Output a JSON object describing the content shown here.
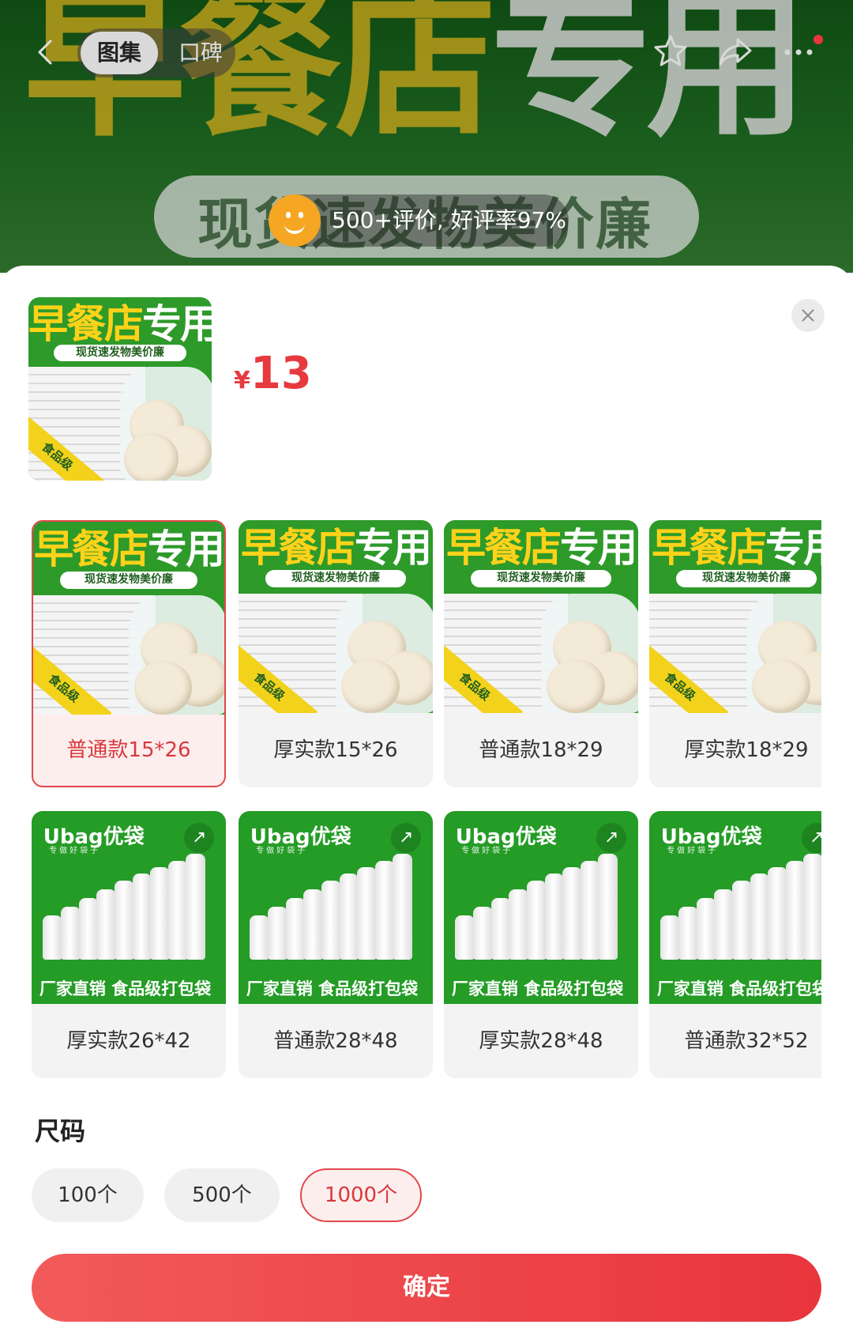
{
  "header": {
    "banner_title_part1": "早餐店",
    "banner_title_part2": "专用",
    "banner_subtitle": "现货速发物美价廉",
    "tabs": [
      {
        "label": "图集",
        "active": true
      },
      {
        "label": "口碑",
        "active": false
      }
    ],
    "review_summary": "500+评价, 好评率97%",
    "icons": [
      "back-arrow-icon",
      "star-icon",
      "share-icon",
      "more-icon"
    ]
  },
  "product": {
    "price_currency": "¥",
    "price_value": "13",
    "image_header_yellow": "早餐店",
    "image_header_white": "专用",
    "image_subtitle": "现货速发物美价廉",
    "image_badge": "食品级"
  },
  "variants": [
    {
      "label": "普通款15*26",
      "style": "a",
      "selected": true
    },
    {
      "label": "厚实款15*26",
      "style": "a",
      "selected": false
    },
    {
      "label": "普通款18*29",
      "style": "a",
      "selected": false
    },
    {
      "label": "厚实款18*29",
      "style": "a",
      "selected": false
    },
    {
      "label": "厚实款26*42",
      "style": "b",
      "selected": false
    },
    {
      "label": "普通款28*48",
      "style": "b",
      "selected": false
    },
    {
      "label": "厚实款28*48",
      "style": "b",
      "selected": false
    },
    {
      "label": "普通款32*52",
      "style": "b",
      "selected": false
    }
  ],
  "variant_image_b": {
    "logo": "Ubag优袋",
    "slogan": "专做好袋子",
    "footer": "厂家直销 食品级打包袋"
  },
  "size": {
    "title": "尺码",
    "options": [
      {
        "label": "100个",
        "selected": false
      },
      {
        "label": "500个",
        "selected": false
      },
      {
        "label": "1000个",
        "selected": true
      }
    ]
  },
  "confirm_label": "确定",
  "colors": {
    "accent_red": "#e63a3e",
    "selected_bg": "#fdeeee",
    "product_green": "#2d9a2a",
    "review_face": "#f5a623"
  }
}
